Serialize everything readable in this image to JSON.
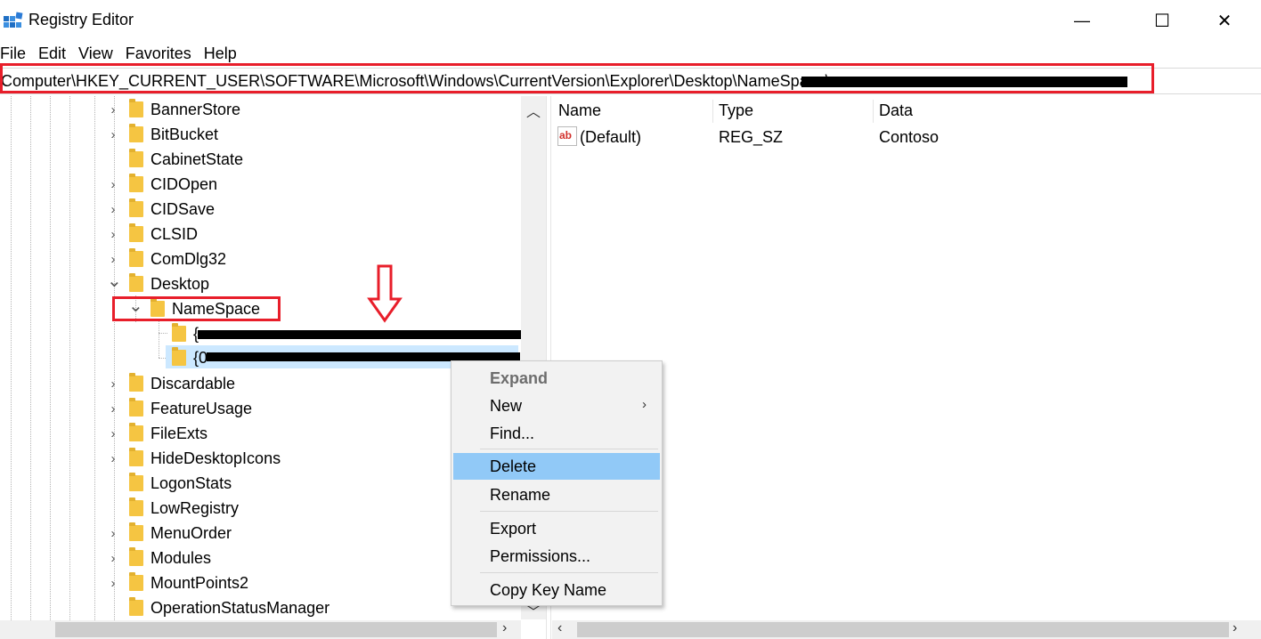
{
  "window": {
    "title": "Registry Editor",
    "minimize": "—",
    "maximize": "☐",
    "close": "✕"
  },
  "menu": [
    "File",
    "Edit",
    "View",
    "Favorites",
    "Help"
  ],
  "address": {
    "path": "Computer\\HKEY_CURRENT_USER\\SOFTWARE\\Microsoft\\Windows\\CurrentVersion\\Explorer\\Desktop\\NameSpace\\"
  },
  "tree": {
    "items": [
      {
        "label": "BannerStore",
        "expander": "›"
      },
      {
        "label": "BitBucket",
        "expander": "›"
      },
      {
        "label": "CabinetState",
        "expander": ""
      },
      {
        "label": "CIDOpen",
        "expander": "›"
      },
      {
        "label": "CIDSave",
        "expander": "›"
      },
      {
        "label": "CLSID",
        "expander": "›"
      },
      {
        "label": "ComDlg32",
        "expander": "›"
      },
      {
        "label": "Desktop",
        "expander": "⌄"
      },
      {
        "label": "NameSpace",
        "expander": "⌄"
      },
      {
        "label": "{",
        "expander": ""
      },
      {
        "label": "{0",
        "expander": ""
      },
      {
        "label": "Discardable",
        "expander": "›"
      },
      {
        "label": "FeatureUsage",
        "expander": "›"
      },
      {
        "label": "FileExts",
        "expander": "›"
      },
      {
        "label": "HideDesktopIcons",
        "expander": "›"
      },
      {
        "label": "LogonStats",
        "expander": ""
      },
      {
        "label": "LowRegistry",
        "expander": ""
      },
      {
        "label": "MenuOrder",
        "expander": "›"
      },
      {
        "label": "Modules",
        "expander": "›"
      },
      {
        "label": "MountPoints2",
        "expander": "›"
      },
      {
        "label": "OperationStatusManager",
        "expander": ""
      }
    ]
  },
  "list": {
    "columns": [
      "Name",
      "Type",
      "Data"
    ],
    "rows": [
      {
        "icon": "ab",
        "name": "(Default)",
        "type": "REG_SZ",
        "data": "Contoso"
      }
    ]
  },
  "context_menu": {
    "items": [
      {
        "label": "Expand"
      },
      {
        "label": "New"
      },
      {
        "label": "Find..."
      },
      {
        "label": "Delete"
      },
      {
        "label": "Rename"
      },
      {
        "label": "Export"
      },
      {
        "label": "Permissions..."
      },
      {
        "label": "Copy Key Name"
      }
    ]
  },
  "colors": {
    "highlight_red": "#e81e2a",
    "selection": "#cce8ff",
    "menu_hover": "#91c9f7",
    "folder": "#f5c542"
  },
  "icons": [
    "registry-editor-icon",
    "folder-icon",
    "string-value-icon",
    "down-arrow-annotation"
  ]
}
